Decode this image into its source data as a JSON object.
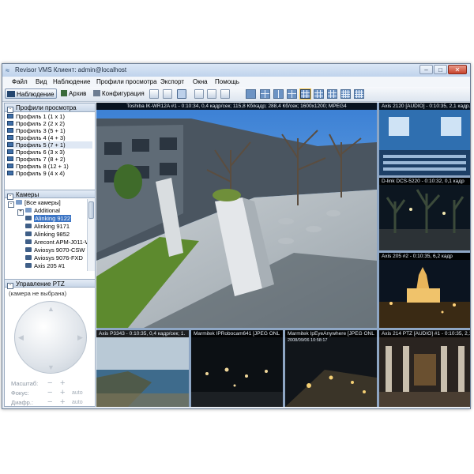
{
  "window": {
    "title": "Revisor VMS Клиент: admin@localhost",
    "buttons": {
      "minimize": "–",
      "maximize": "□",
      "close": "✕"
    }
  },
  "menu": [
    "Файл",
    "Вид",
    "Наблюдение",
    "Профили просмотра",
    "Экспорт",
    "Окна",
    "Помощь"
  ],
  "toolbar": {
    "modes": [
      {
        "label": "Наблюдение",
        "active": true
      },
      {
        "label": "Архив",
        "active": false
      },
      {
        "label": "Конфигурация",
        "active": false
      }
    ]
  },
  "profiles": {
    "header": "Профили просмотра",
    "items": [
      "Профиль 1 (1 x 1)",
      "Профиль 2 (2 x 2)",
      "Профиль 3 (5 + 1)",
      "Профиль 4 (4 + 3)",
      "Профиль 5 (7 + 1)",
      "Профиль 6 (3 x 3)",
      "Профиль 7 (8 + 2)",
      "Профиль 8 (12 + 1)",
      "Профиль 9 (4 x 4)"
    ]
  },
  "cameras": {
    "header": "Камеры",
    "root": "[Все камеры]",
    "items": [
      "Additional",
      "Alinking 9122",
      "Alinking 9171",
      "Alinking 9852",
      "Arecont APM-J011-WS",
      "Aviosys 9070-CSW",
      "Aviosys 9076-FXD",
      "Axis 205 #1"
    ]
  },
  "ptz": {
    "header": "Управление PTZ",
    "status": "(камера не выбрана)",
    "rows": [
      {
        "label": "Масштаб:",
        "auto": ""
      },
      {
        "label": "Фокус:",
        "auto": "auto"
      },
      {
        "label": "Диафр.:",
        "auto": "auto"
      }
    ]
  },
  "tiles": {
    "main": {
      "caption": "Toshiba IK-WR12A #1 - 0:10:34, 0,4 кадр/сек; 115,8 Кб/кадр; 288,4 Кб/сек; 1600x1200; MPEG4"
    },
    "right1": {
      "caption": "Axis 2120 [AUDIO] - 0:10:35, 2,1 кадр."
    },
    "right2": {
      "caption": "D-link DCS-5220 - 0:10:32, 0,1 кадр"
    },
    "right3": {
      "caption": "Axis 205 #2 - 0:10:35, 6,2 кадр"
    },
    "bottom1": {
      "caption": "Axis P3343 - 0:10:35, 0,4 кадр/сек; 1."
    },
    "bottom2": {
      "caption": "Marmitek IPRobocam641 [JPEG ONL"
    },
    "bottom3": {
      "caption": "Marmitek IpEyeAnywhere [JPEG ONL",
      "timestamp": "2008/09/06 10:58:17"
    },
    "bottom4": {
      "caption": "Axis 214 PTZ [AUDIO] #1 - 0:10:35, 2,1 к"
    }
  },
  "colors": {
    "accent": "#3b74c4",
    "titlebar": "#bfd3ec",
    "video_caption_bg": "#000000"
  }
}
